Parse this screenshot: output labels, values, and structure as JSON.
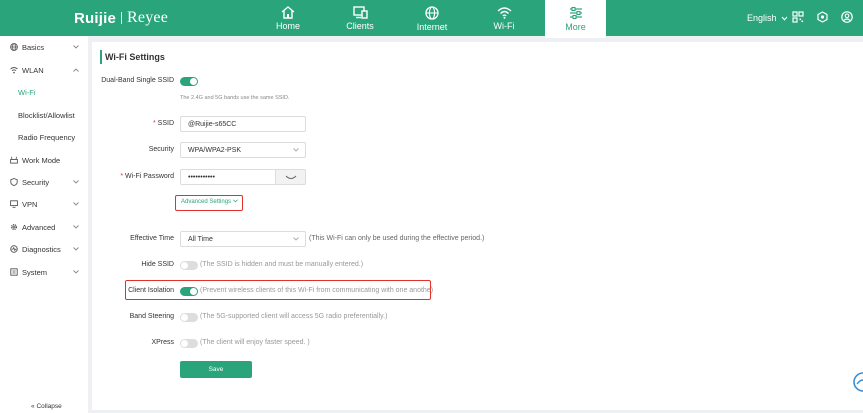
{
  "brand": {
    "logo_left": "Ruijie",
    "logo_right": "Reyee"
  },
  "nav": {
    "tabs": [
      {
        "label": "Home",
        "icon": "home-icon"
      },
      {
        "label": "Clients",
        "icon": "clients-icon"
      },
      {
        "label": "Internet",
        "icon": "globe-icon"
      },
      {
        "label": "Wi-Fi",
        "icon": "wifi-icon"
      },
      {
        "label": "More",
        "icon": "sliders-icon",
        "active": true
      }
    ],
    "language": "English"
  },
  "sidebar": {
    "items": [
      {
        "label": "Basics",
        "icon": "globe-icon",
        "expandable": true
      },
      {
        "label": "WLAN",
        "icon": "wifi-icon",
        "expandable": true
      },
      {
        "label": "Wi-Fi",
        "sub": true,
        "active": true
      },
      {
        "label": "Blocklist/Allowlist",
        "sub": true
      },
      {
        "label": "Radio Frequency",
        "sub": true
      },
      {
        "label": "Work Mode",
        "icon": "router-icon"
      },
      {
        "label": "Security",
        "icon": "shield-icon",
        "expandable": true
      },
      {
        "label": "VPN",
        "icon": "vpn-icon",
        "expandable": true
      },
      {
        "label": "Advanced",
        "icon": "gear-icon",
        "expandable": true
      },
      {
        "label": "Diagnostics",
        "icon": "diagnostics-icon",
        "expandable": true
      },
      {
        "label": "System",
        "icon": "system-icon",
        "expandable": true
      }
    ],
    "collapse_label": "Collapse"
  },
  "form": {
    "title": "Wi-Fi Settings",
    "dual_band": {
      "label": "Dual-Band Single SSID",
      "on": true,
      "note": "The 2.4G and 5G bands use the same SSID."
    },
    "ssid": {
      "label": "SSID",
      "value": "@Ruijie-s65CC"
    },
    "security": {
      "label": "Security",
      "value": "WPA/WPA2-PSK"
    },
    "password": {
      "label": "Wi-Fi Password",
      "value": "•••••••••••"
    },
    "advanced_settings": "Advanced Settings",
    "effective_time": {
      "label": "Effective Time",
      "value": "All Time",
      "hint": "(This Wi-Fi can only be used during the effective period.)"
    },
    "hide_ssid": {
      "label": "Hide SSID",
      "on": false,
      "hint": "(The SSID is hidden and must be manually entered.)"
    },
    "client_isolation": {
      "label": "Client Isolation",
      "on": true,
      "hint": "(Prevent wireless clients of this Wi-Fi from communicating with one anothe)"
    },
    "band_steering": {
      "label": "Band Steering",
      "on": false,
      "hint": "(The 5G-supported client will access 5G radio preferentially.)"
    },
    "xpress": {
      "label": "XPress",
      "on": false,
      "hint": "(The client will enjoy faster speed. )"
    },
    "save_label": "Save"
  },
  "colors": {
    "brand_green": "#2aa57b",
    "highlight_red": "#e0322b"
  }
}
